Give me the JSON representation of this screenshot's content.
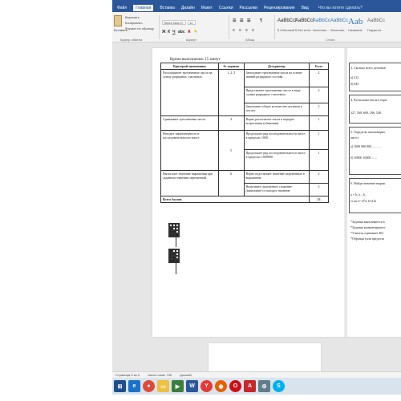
{
  "ribbon": {
    "tabs": [
      "Файл",
      "Главная",
      "Вставка",
      "Дизайн",
      "Макет",
      "Ссылки",
      "Рассылки",
      "Рецензирование",
      "Вид"
    ],
    "active_tab": "Главная",
    "tell_me": "Что вы хотите сделать?",
    "clipboard": {
      "cut": "Вырезать",
      "copy": "Копировать",
      "paste": "Вставить",
      "format_painter": "Формат по образцу",
      "group": "Буфер обмена"
    },
    "font": {
      "name": "Times New R",
      "size": "12",
      "group": "Шрифт"
    },
    "paragraph_group": "Абзац",
    "styles": [
      {
        "sample": "AaBbCcI",
        "name": "¶ Обычный"
      },
      {
        "sample": "AaBbCcI",
        "name": "¶ Без инте..."
      },
      {
        "sample": "AaBbCc",
        "name": "Заголово..."
      },
      {
        "sample": "AaBbCc",
        "name": "Заголово..."
      },
      {
        "sample": "Aab",
        "name": "Название"
      },
      {
        "sample": "AaBbCc",
        "name": "Подзагол..."
      }
    ],
    "styles_group": "Стили"
  },
  "page1": {
    "time": "Время выполнения: 15 минут",
    "headers": [
      "Критерий оценивания",
      "№ задания",
      "Дескриптор",
      "Балл"
    ],
    "rows": [
      {
        "criterion": "Раскладывает трехзначные числа на сумму разрядных слагаемых.",
        "task": "1, 2, 3",
        "descriptor": "Записывает трехзначные числа на основе знаний разрядного состава.",
        "score": "2"
      },
      {
        "criterion": "",
        "task": "",
        "descriptor": "Представляет трехзначные числа в виде суммы разрядных слагаемых.",
        "score": "2"
      },
      {
        "criterion": "",
        "task": "",
        "descriptor": "Записывает общее количество десятков в числах.",
        "score": "2"
      },
      {
        "criterion": "Сравнивает трехзначные числа.",
        "task": "4",
        "descriptor": "Верно располагает числа в порядке возрастания (убывания)",
        "score": "1"
      },
      {
        "criterion": "Находит закономерность в последовательности чисел.",
        "task": "",
        "descriptor": "Продолжает ряд последовательности чисел в пределах 1000.",
        "score": "1"
      },
      {
        "criterion": "",
        "task": "5",
        "descriptor": "Продолжает ряд последовательности чисел в пределах 1000000.",
        "score": "1"
      },
      {
        "criterion": "Вычисляет значение выражения при заданном значении переменной.",
        "task": "6",
        "descriptor": "Верно подставляет значение переменных в выражение.",
        "score": "2"
      },
      {
        "criterion": "",
        "task": "",
        "descriptor": "Выполняет письменное сложение (вычитание) и находит значение.",
        "score": "2"
      }
    ],
    "total_label": "Всего баллов",
    "total": "13"
  },
  "page2": {
    "q3": "3. Сколько всего десятков",
    "q3a": "а) 412",
    "q3b": "б) 845",
    "q4": "4. Расположи числа в поря",
    "q4nums": "327, 568, 609, 296, 540.",
    "q5": "5. Определи закономерно",
    "q5b": "чисел.",
    "q5a1": "а) 1000  900  800  ...  ...  ...",
    "q5a2": "б) 10000  10000  ...  ...",
    "q6": "6. Найди значение выраж",
    "q6expr": "a + b, a – b,",
    "q6cond": "если a= 474, b=412",
    "n1": "*Задания выполняются в",
    "n2": "*Задания комментируютс",
    "n3": "*Учитель оценивает КО",
    "n4": "*Образцы (или предоста"
  },
  "status": {
    "page": "Страница 3 из 3",
    "words": "Число слов: 730",
    "lang": "русский"
  },
  "taskbar_icons": [
    "start-icon",
    "ie-icon",
    "chrome-icon",
    "explorer-icon",
    "media-icon",
    "word-icon",
    "yandex-icon",
    "firefox-icon",
    "opera-icon",
    "pdf-icon",
    "settings-icon",
    "skype-icon"
  ]
}
